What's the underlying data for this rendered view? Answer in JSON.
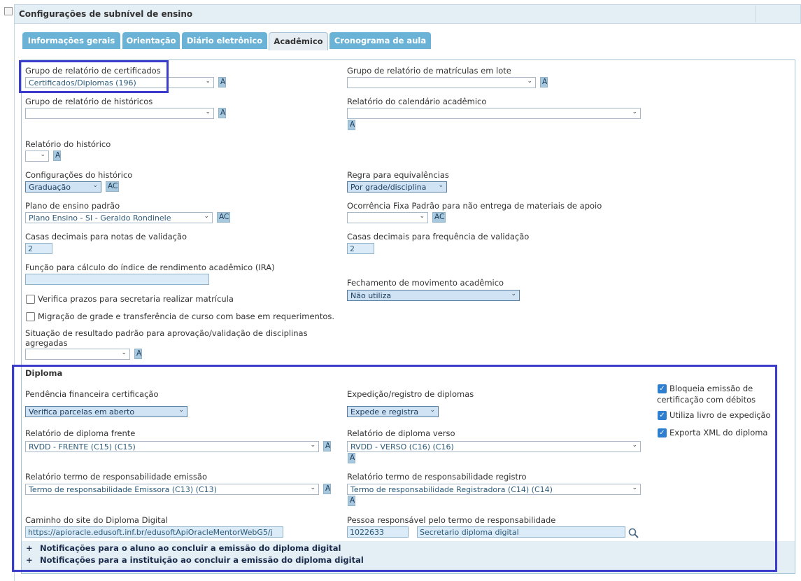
{
  "panel": {
    "title": "Configurações de subnível de ensino"
  },
  "tabs": [
    {
      "label": "Informações gerais"
    },
    {
      "label": "Orientação"
    },
    {
      "label": "Diário eletrônico"
    },
    {
      "label": "Acadêmico"
    },
    {
      "label": "Cronograma de aula"
    }
  ],
  "form": {
    "grupo_certificados": {
      "label": "Grupo de relatório de certificados",
      "value": "Certificados/Diplomas (196)"
    },
    "grupo_matriculas": {
      "label": "Grupo de relatório de matrículas em lote",
      "value": ""
    },
    "grupo_historicos": {
      "label": "Grupo de relatório de históricos",
      "value": ""
    },
    "relatorio_calendario": {
      "label": "Relatório do calendário acadêmico",
      "value": ""
    },
    "relatorio_historico": {
      "label": "Relatório do histórico",
      "value": ""
    },
    "config_historico": {
      "label": "Configurações do histórico",
      "value": "Graduação"
    },
    "regra_equivalencias": {
      "label": "Regra para equivalências",
      "value": "Por grade/disciplina"
    },
    "plano_ensino": {
      "label": "Plano de ensino padrão",
      "value": "Plano Ensino - SI - Geraldo Rondinele"
    },
    "ocorrencia_fixa": {
      "label": "Ocorrência Fixa Padrão para não entrega de materiais de apoio",
      "value": ""
    },
    "casas_notas": {
      "label": "Casas decimais para notas de validação",
      "value": "2"
    },
    "casas_frequencia": {
      "label": "Casas decimais para frequência de validação",
      "value": "2"
    },
    "funcao_ira": {
      "label": "Função para cálculo do índice de rendimento acadêmico (IRA)",
      "value": ""
    },
    "fechamento": {
      "label": "Fechamento de movimento acadêmico",
      "value": "Não utiliza"
    },
    "verifica_prazos": {
      "label": "Verifica prazos para secretaria realizar matrícula"
    },
    "migracao_grade": {
      "label": "Migração de grade e transferência de curso com base em requerimentos."
    },
    "situacao_resultado": {
      "label_line1": "Situação de resultado padrão para aprovação/validação de disciplinas",
      "label_line2": "agregadas",
      "value": ""
    }
  },
  "buttons": {
    "a": "A",
    "ac": "AC"
  },
  "diploma": {
    "title": "Diploma",
    "pendencia": {
      "label": "Pendência financeira certificação",
      "value": "Verifica parcelas em aberto"
    },
    "expedicao": {
      "label": "Expedição/registro de diplomas",
      "value": "Expede e registra"
    },
    "frente": {
      "label": "Relatório de diploma frente",
      "value": "RVDD - FRENTE (C15) (C15)"
    },
    "verso": {
      "label": "Relatório de diploma verso",
      "value": "RVDD - VERSO (C16) (C16)"
    },
    "termo_emissao": {
      "label": "Relatório termo de responsabilidade emissão",
      "value": "Termo de responsabilidade Emissora (C13) (C13)"
    },
    "termo_registro": {
      "label": "Relatório termo de responsabilidade registro",
      "value": "Termo de responsabilidade Registradora (C14) (C14)"
    },
    "caminho": {
      "label": "Caminho do site do Diploma Digital",
      "value": "https://apioracle.edusoft.inf.br/edusoftApiOracleMentorWebG5/j"
    },
    "pessoa": {
      "label": "Pessoa responsável pelo termo de responsabilidade",
      "code": "1022633",
      "name": "Secretario diploma digital"
    },
    "bloqueia": {
      "label_line1": "Bloqueia emissão de",
      "label_line2": "certificação com débitos",
      "checked": true
    },
    "livro": {
      "label": "Utiliza livro de expedição",
      "checked": true
    },
    "xml": {
      "label": "Exporta XML do diploma",
      "checked": true
    }
  },
  "notifications": [
    {
      "prefix": "+",
      "label": "Notificações para o aluno ao concluir a emissão do diploma digital"
    },
    {
      "prefix": "+",
      "label": "Notificações para a instituição ao concluir a emissão do diploma digital"
    }
  ],
  "colors": {
    "highlight": "#3b3bcc",
    "tab": "#6ab3d6",
    "header": "#e4eef5"
  }
}
